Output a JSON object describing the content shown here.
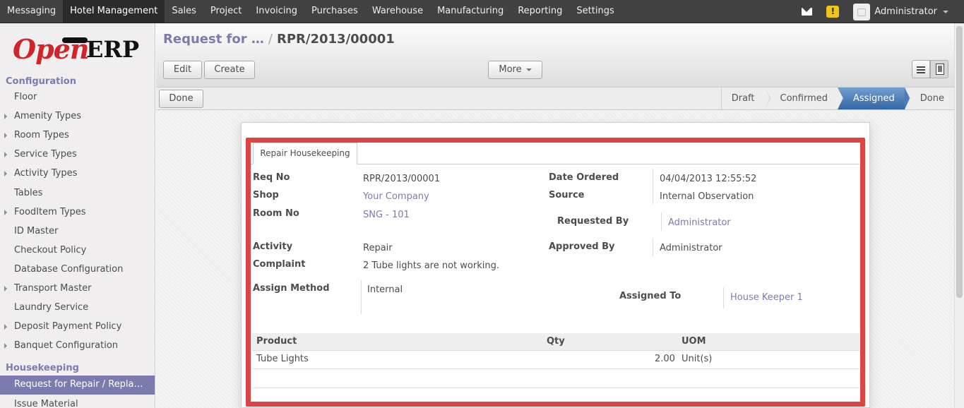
{
  "topbar": {
    "menu": [
      "Messaging",
      "Hotel Management",
      "Sales",
      "Project",
      "Invoicing",
      "Purchases",
      "Warehouse",
      "Manufacturing",
      "Reporting",
      "Settings"
    ],
    "user": "Administrator",
    "warning_glyph": "!"
  },
  "logo": {
    "open": "Open",
    "erp": "ERP"
  },
  "sidebar": {
    "config_head": "Configuration",
    "items": [
      {
        "label": "Floor",
        "expandable": false
      },
      {
        "label": "Amenity Types",
        "expandable": true
      },
      {
        "label": "Room Types",
        "expandable": true
      },
      {
        "label": "Service Types",
        "expandable": true
      },
      {
        "label": "Activity Types",
        "expandable": true
      },
      {
        "label": "Tables",
        "expandable": false
      },
      {
        "label": "FoodItem Types",
        "expandable": true
      },
      {
        "label": "ID Master",
        "expandable": false
      },
      {
        "label": "Checkout Policy",
        "expandable": false
      },
      {
        "label": "Database Configuration",
        "expandable": false
      },
      {
        "label": "Transport Master",
        "expandable": true
      },
      {
        "label": "Laundry Service",
        "expandable": false
      },
      {
        "label": "Deposit Payment Policy",
        "expandable": true
      },
      {
        "label": "Banquet Configuration",
        "expandable": true
      }
    ],
    "housekeeping_head": "Housekeeping",
    "active_item": "Request for Repair / Repla…",
    "after_item": "Issue Material"
  },
  "breadcrumb": {
    "parent": "Request for …",
    "sep": "/",
    "current": "RPR/2013/00001"
  },
  "toolbar": {
    "edit": "Edit",
    "create": "Create",
    "more": "More"
  },
  "statusbar": {
    "done_button": "Done",
    "stages": [
      "Draft",
      "Confirmed",
      "Assigned",
      "Done"
    ],
    "selected": "Assigned"
  },
  "form": {
    "tab": "Repair Housekeeping",
    "req_no_label": "Req No",
    "req_no": "RPR/2013/00001",
    "shop_label": "Shop",
    "shop": "Your Company",
    "room_label": "Room No",
    "room": "SNG - 101",
    "date_label": "Date Ordered",
    "date": "04/04/2013 12:55:52",
    "source_label": "Source",
    "source": "Internal Observation",
    "requested_label": "Requested By",
    "requested": "Administrator",
    "activity_label": "Activity",
    "activity": "Repair",
    "complaint_label": "Complaint",
    "complaint": "2 Tube lights are not working.",
    "approved_label": "Approved By",
    "approved": "Administrator",
    "assign_label": "Assign Method",
    "assign": "Internal",
    "assigned_label": "Assigned To",
    "assigned": "House Keeper 1"
  },
  "table": {
    "headers": {
      "product": "Product",
      "qty": "Qty",
      "uom": "UOM"
    },
    "rows": [
      {
        "product": "Tube Lights",
        "qty": "2.00",
        "uom": "Unit(s)"
      }
    ]
  },
  "colors": {
    "accent": "#7c7bad",
    "highlight": "#dd4444",
    "stage_selected": "#4a7cbf"
  }
}
